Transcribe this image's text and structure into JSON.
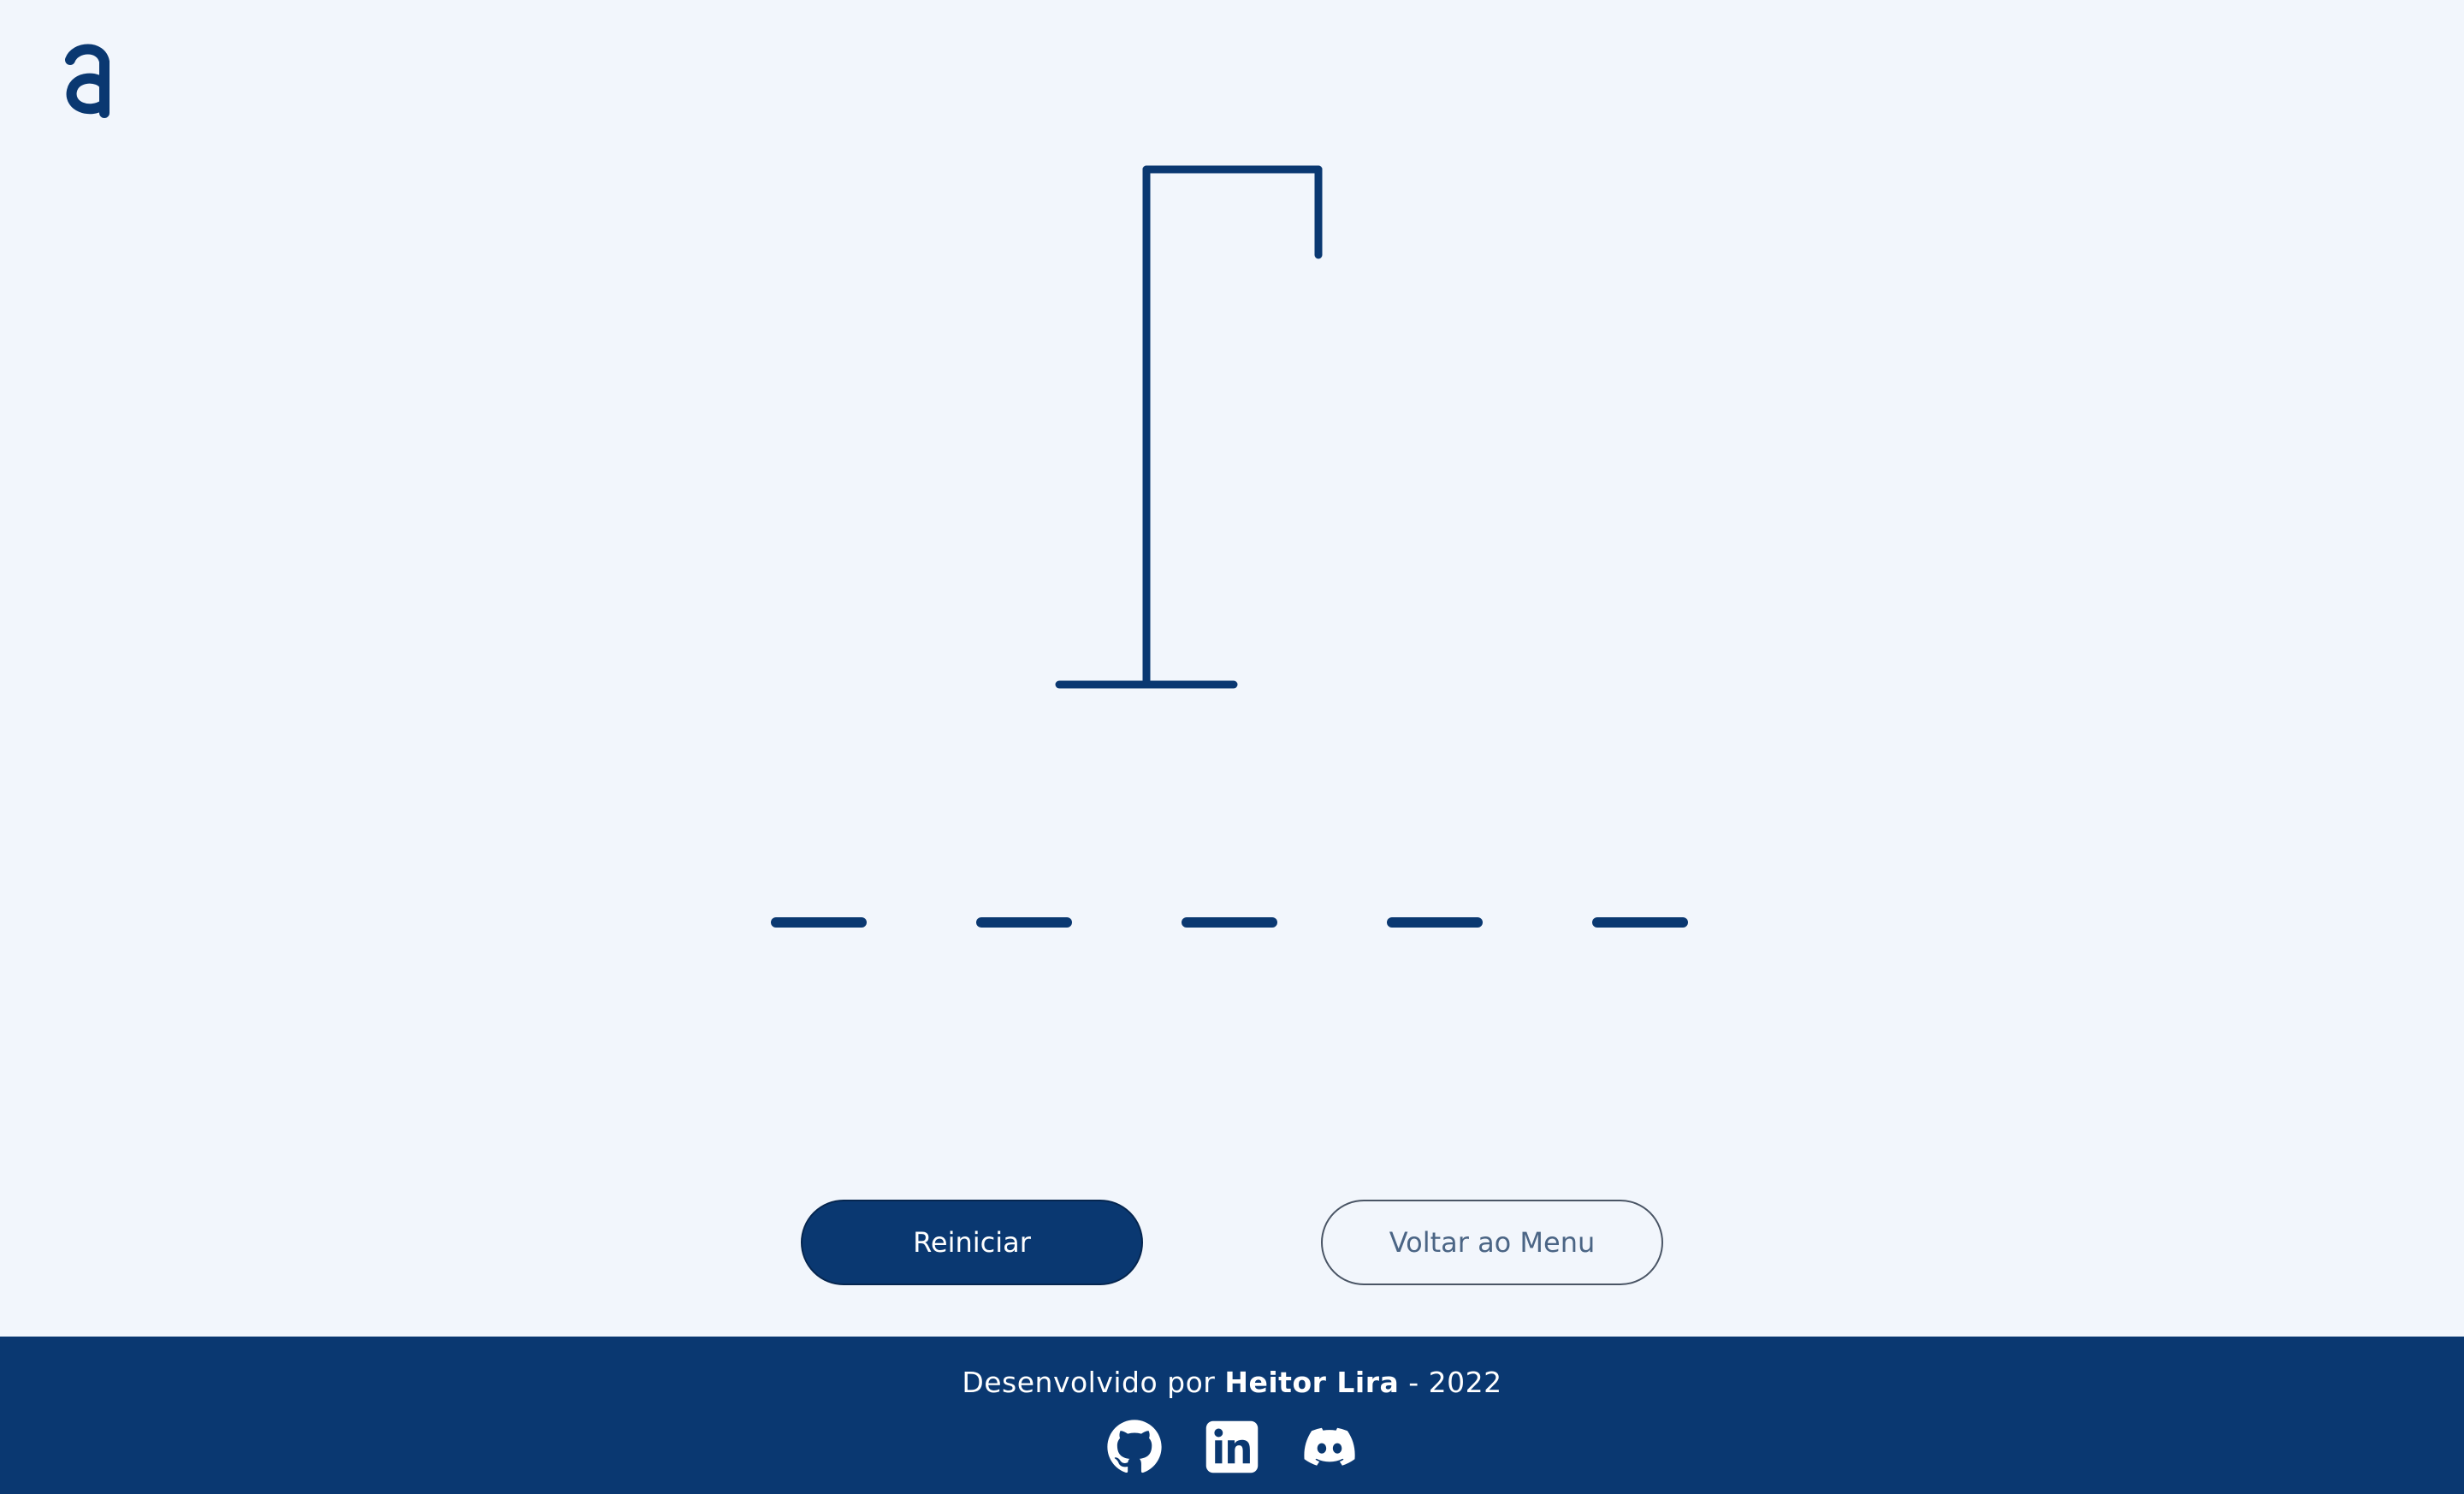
{
  "colors": {
    "background": "#f2f6fc",
    "primary": "#0a3871",
    "secondary_text": "#4b6585"
  },
  "logo": {
    "icon": "alura-a-logo"
  },
  "game": {
    "word_length": 5,
    "revealed_letters": [
      "",
      "",
      "",
      "",
      ""
    ],
    "errors": 0
  },
  "buttons": {
    "restart_label": "Reiniciar",
    "menu_label": "Voltar ao Menu"
  },
  "footer": {
    "credit_prefix": "Desenvolvido por",
    "author": "Heitor Lira",
    "credit_suffix": "- 2022",
    "social": [
      {
        "icon": "github-icon"
      },
      {
        "icon": "linkedin-icon"
      },
      {
        "icon": "discord-icon"
      }
    ]
  }
}
